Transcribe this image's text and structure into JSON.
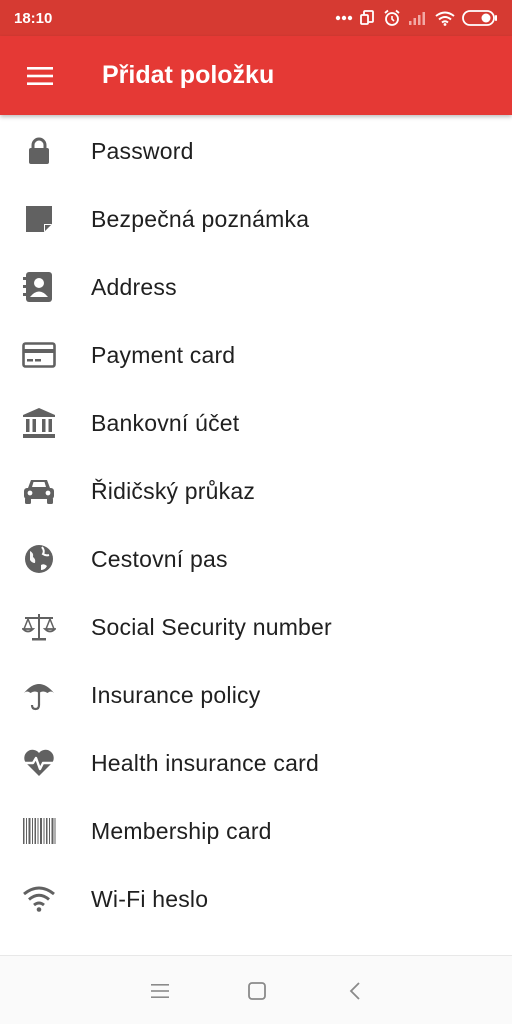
{
  "status_bar": {
    "time": "18:10",
    "icons": [
      "more-dots-icon",
      "screenshot-icon",
      "alarm-icon",
      "signal-icon",
      "wifi-icon",
      "battery-icon"
    ]
  },
  "app_bar": {
    "title": "Přidat položku",
    "menu_icon": "hamburger-menu-icon",
    "color": "#e53935"
  },
  "items": [
    {
      "label": "Password",
      "icon": "lock-icon"
    },
    {
      "label": "Bezpečná poznámka",
      "icon": "note-icon"
    },
    {
      "label": "Address",
      "icon": "contact-book-icon"
    },
    {
      "label": "Payment card",
      "icon": "credit-card-icon"
    },
    {
      "label": "Bankovní účet",
      "icon": "bank-icon"
    },
    {
      "label": "Řidičský průkaz",
      "icon": "car-icon"
    },
    {
      "label": "Cestovní pas",
      "icon": "globe-icon"
    },
    {
      "label": "Social Security number",
      "icon": "scales-icon"
    },
    {
      "label": "Insurance policy",
      "icon": "umbrella-icon"
    },
    {
      "label": "Health insurance card",
      "icon": "heart-pulse-icon"
    },
    {
      "label": "Membership card",
      "icon": "barcode-icon"
    },
    {
      "label": "Wi-Fi heslo",
      "icon": "wifi-icon"
    }
  ],
  "nav_bar": {
    "buttons": [
      "recent-apps-icon",
      "home-icon",
      "back-icon"
    ]
  }
}
